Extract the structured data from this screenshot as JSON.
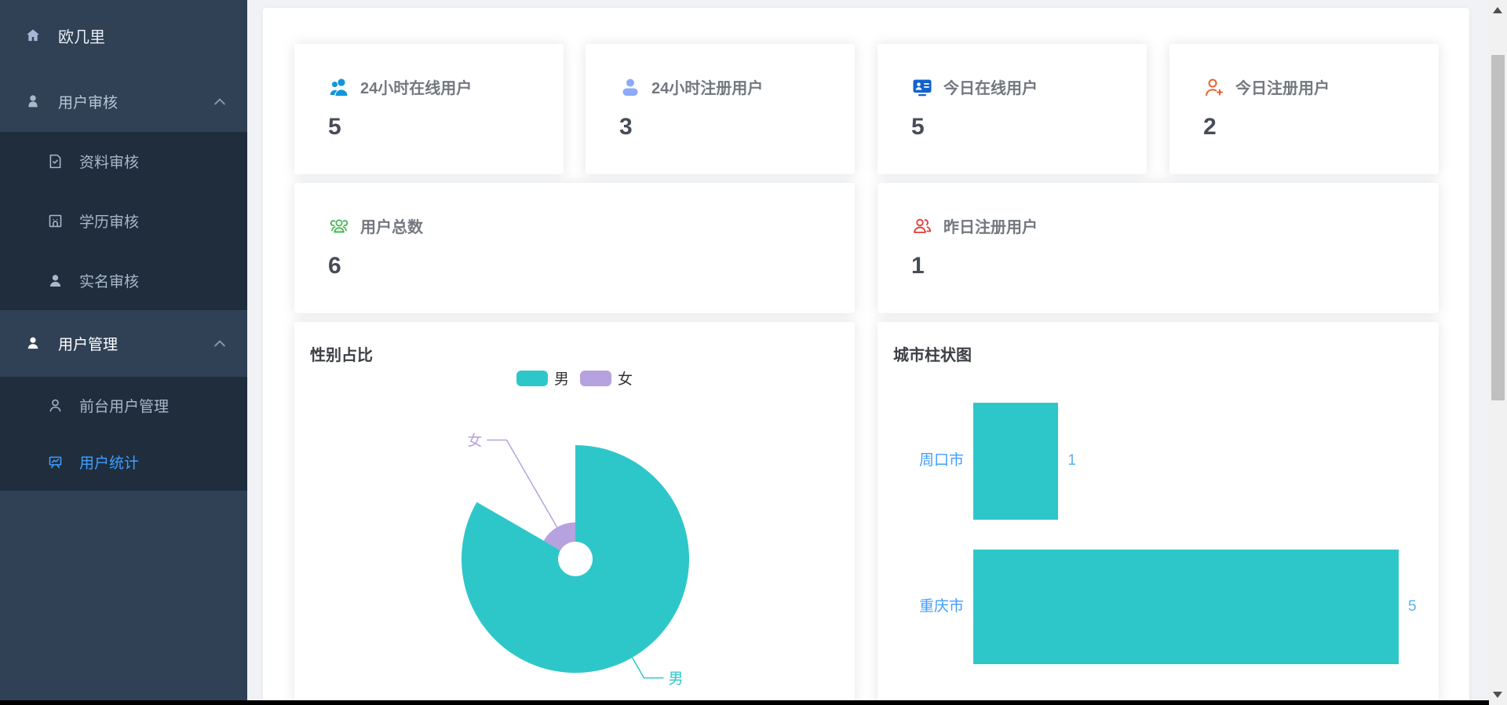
{
  "sidebar": {
    "logo": "欧几里",
    "sections": [
      {
        "label": "用户审核",
        "icon": "user-solid-icon",
        "expanded": true,
        "children": [
          {
            "label": "资料审核",
            "icon": "document-check-icon",
            "active": false
          },
          {
            "label": "学历审核",
            "icon": "building-icon",
            "active": false
          },
          {
            "label": "实名审核",
            "icon": "user-icon",
            "active": false
          }
        ]
      },
      {
        "label": "用户管理",
        "icon": "user-icon",
        "expanded": true,
        "children": [
          {
            "label": "前台用户管理",
            "icon": "user-outline-icon",
            "active": false
          },
          {
            "label": "用户统计",
            "icon": "chart-board-icon",
            "active": true
          }
        ]
      }
    ]
  },
  "stat_cards": [
    {
      "label": "24小时在线用户",
      "value": "5",
      "icon": "users-group-icon",
      "icon_color": "#1296db"
    },
    {
      "label": "24小时注册用户",
      "value": "3",
      "icon": "user-icon",
      "icon_color": "#8cabf8"
    },
    {
      "label": "今日在线用户",
      "value": "5",
      "icon": "id-card-icon",
      "icon_color": "#1163cc"
    },
    {
      "label": "今日注册用户",
      "value": "2",
      "icon": "user-add-icon",
      "icon_color": "#e8602f"
    },
    {
      "label": "用户总数",
      "value": "6",
      "icon": "users-outline-icon",
      "icon_color": "#3fb34f"
    },
    {
      "label": "昨日注册用户",
      "value": "1",
      "icon": "users-outline-icon",
      "icon_color": "#e23c39"
    }
  ],
  "chart_data": [
    {
      "type": "pie",
      "rose": true,
      "title": "性别占比",
      "labels": [
        "男",
        "女"
      ],
      "values": [
        5,
        1
      ],
      "colors": [
        "#2ec7c9",
        "#b6a2de"
      ],
      "legend_position": "top",
      "donut_inner_radius": true
    },
    {
      "type": "bar",
      "orientation": "horizontal",
      "title": "城市柱状图",
      "categories": [
        "周口市",
        "重庆市"
      ],
      "values": [
        1,
        5
      ],
      "bar_color": "#2ec7c9",
      "label_color": "#409eff",
      "value_color": "#5ab1ef",
      "xlim": [
        0,
        5
      ]
    }
  ],
  "colors": {
    "sidebar_bg": "#304156",
    "submenu_bg": "#1f2d3d",
    "menu_active": "#409eff",
    "page_bg": "#f0f2f5"
  }
}
